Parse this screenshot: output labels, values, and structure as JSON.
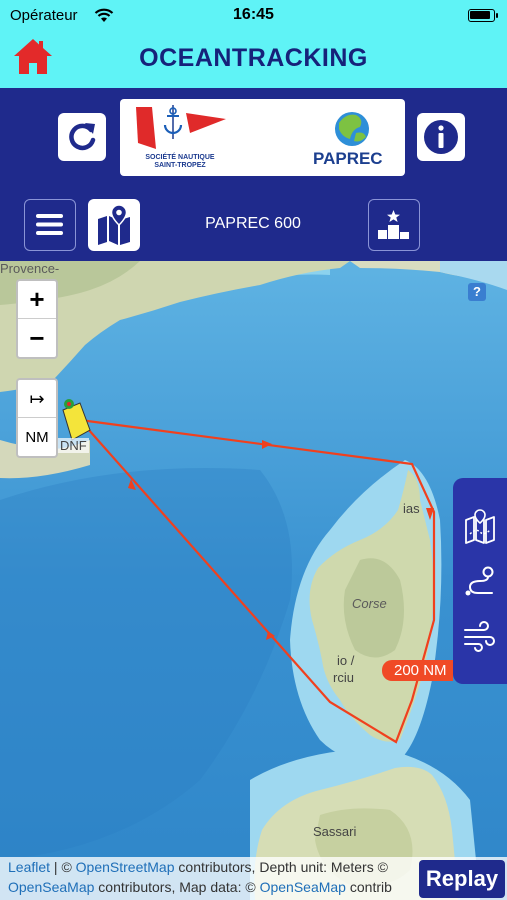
{
  "status_bar": {
    "carrier": "Opérateur",
    "time": "16:45"
  },
  "app": {
    "title": "OCEANTRACKING"
  },
  "logos": {
    "snst_name": "SOCIÉTÉ NAUTIQUE SAINT-TROPEZ",
    "sponsor_name": "PAPREC"
  },
  "race": {
    "name": "PAPREC 600"
  },
  "map": {
    "zoom_in_label": "+",
    "zoom_out_label": "−",
    "unit_toggle_icon": "↦",
    "unit_label": "NM",
    "distance_label": "200 NM",
    "boat_tag": "DNF",
    "help_label": "?",
    "place_labels": {
      "provence": "Provence-",
      "corse": "Corse",
      "ajaccio_a": "io /",
      "ajaccio_b": "rciu",
      "bastia": "ias",
      "sassari": "Sassari"
    },
    "route_color": "#f0401e"
  },
  "side_tools": [
    "map-route-icon",
    "route-path-icon",
    "wind-icon"
  ],
  "attribution": {
    "leaflet": "Leaflet",
    "sep1": " | © ",
    "osm": "OpenStreetMap",
    "line1_rest": " contributors, Depth unit: Meters ©",
    "osea": "OpenSeaMap",
    "line2_mid": " contributors, Map data: © ",
    "osea2": "OpenSeaMap",
    "line2_rest": " contrib"
  },
  "replay_button": {
    "label": "Replay"
  }
}
